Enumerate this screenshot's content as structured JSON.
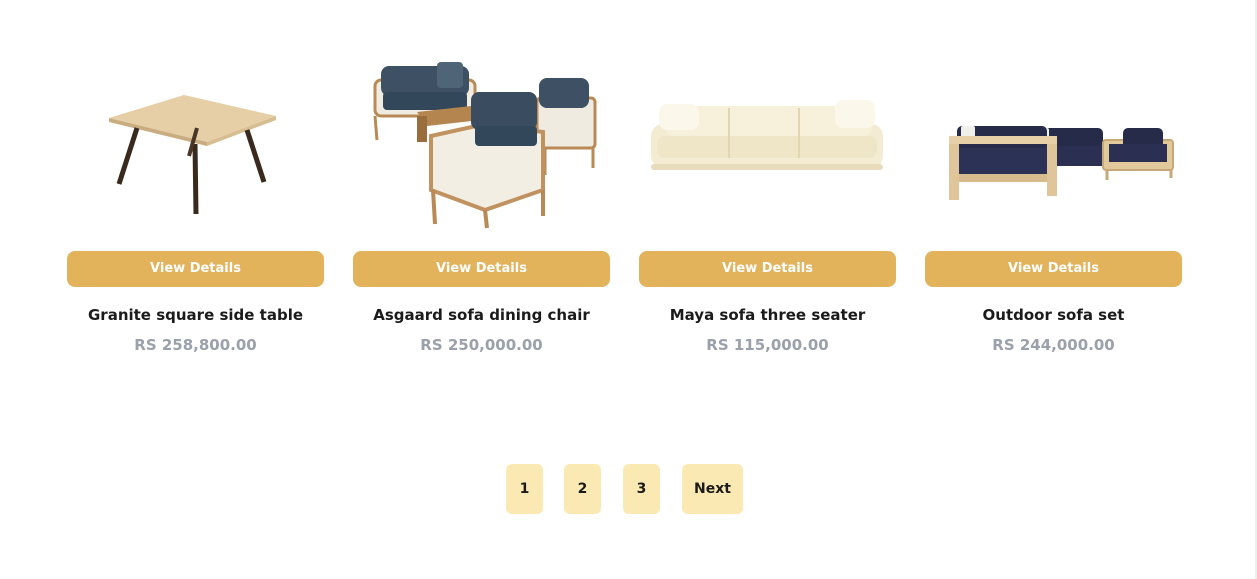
{
  "products": [
    {
      "name": "Granite square side table",
      "price": "RS 258,800.00",
      "button": "View Details",
      "icon": "side-table-image"
    },
    {
      "name": "Asgaard sofa dining chair",
      "price": "RS 250,000.00",
      "button": "View Details",
      "icon": "dining-chair-set-image"
    },
    {
      "name": "Maya sofa three seater",
      "price": "RS 115,000.00",
      "button": "View Details",
      "icon": "three-seater-sofa-image"
    },
    {
      "name": "Outdoor sofa set",
      "price": "RS 244,000.00",
      "button": "View Details",
      "icon": "outdoor-sofa-set-image"
    }
  ],
  "pagination": {
    "pages": [
      "1",
      "2",
      "3"
    ],
    "next": "Next"
  },
  "colors": {
    "accent": "#e3b35c",
    "pager_bg": "#fbe9b3",
    "price_text": "#9aa0ac"
  }
}
